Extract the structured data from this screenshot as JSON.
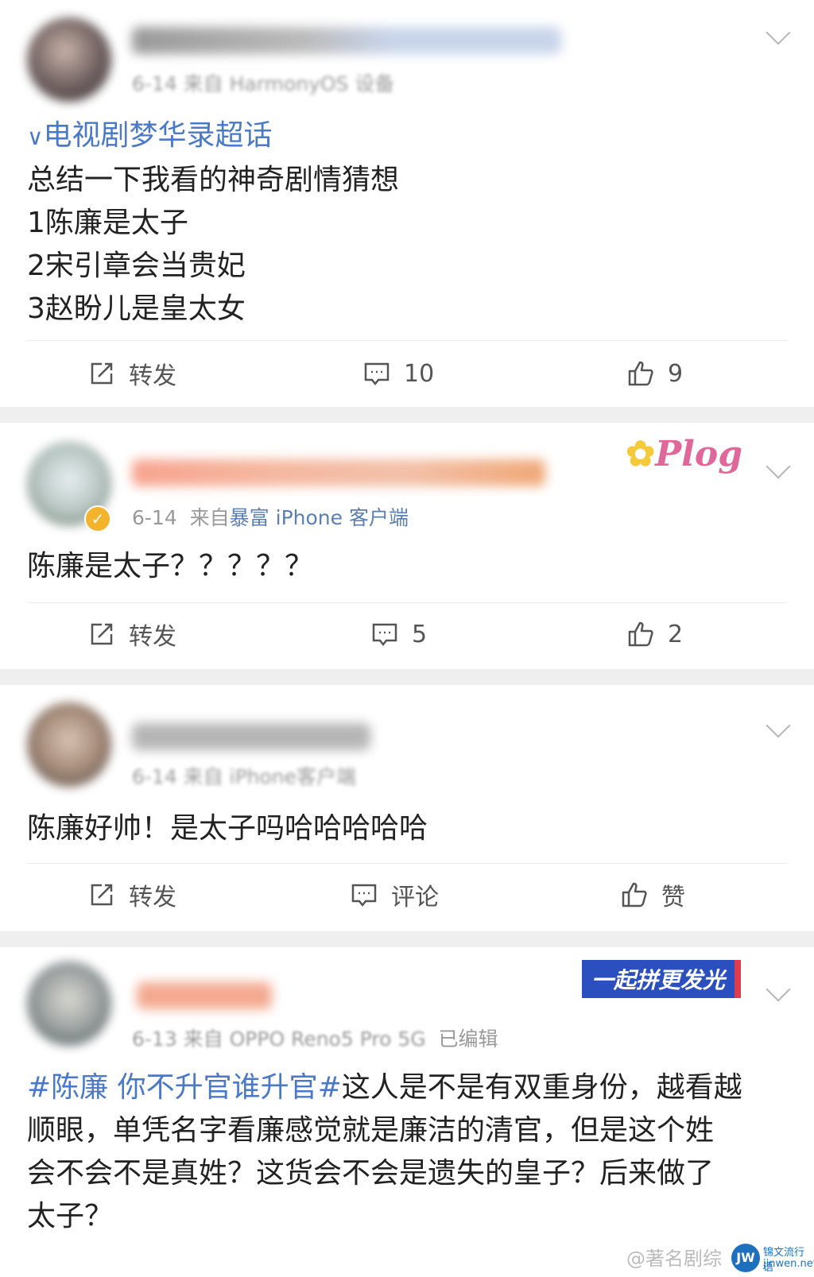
{
  "posts": [
    {
      "meta": "6-14 来自 HarmonyOS 设备",
      "lines": [
        "电视剧梦华录超话",
        "总结一下我看的神奇剧情猜想",
        "1陈廉是太子",
        "2宋引章会当贵妃",
        "3赵盼儿是皇太女"
      ],
      "repost": "转发",
      "comment": "10",
      "like": "9"
    },
    {
      "meta_date": "6-14",
      "meta_from": "来自",
      "meta_src": "暴富 iPhone 客户端",
      "badge": "Plog",
      "lines": [
        "陈廉是太子？？？？？"
      ],
      "repost": "转发",
      "comment": "5",
      "like": "2"
    },
    {
      "meta": "6-14 来自 iPhone客户端",
      "lines": [
        "陈廉好帅！是太子吗哈哈哈哈哈"
      ],
      "repost": "转发",
      "comment": "评论",
      "like": "赞"
    },
    {
      "meta": "6-13 来自 OPPO Reno5 Pro 5G",
      "edited": "已编辑",
      "badge": "一起拼更发光",
      "tag": "#陈廉 你不升官谁升官#",
      "text_after_tag": "这人是不是有双重身份，越看越",
      "lines": [
        "顺眼，单凭名字看廉感觉就是廉洁的清官，但是这个姓",
        "会不会不是真姓？这货会不会是遗失的皇子？后来做了",
        "太子？"
      ]
    }
  ],
  "watermark": "@著名剧综",
  "site": {
    "name": "锦文流行语",
    "url": "jinwen.net",
    "logo": "JW"
  },
  "colors": {
    "link": "#4a79c7",
    "meta": "#999999",
    "separator": "#efefef"
  }
}
